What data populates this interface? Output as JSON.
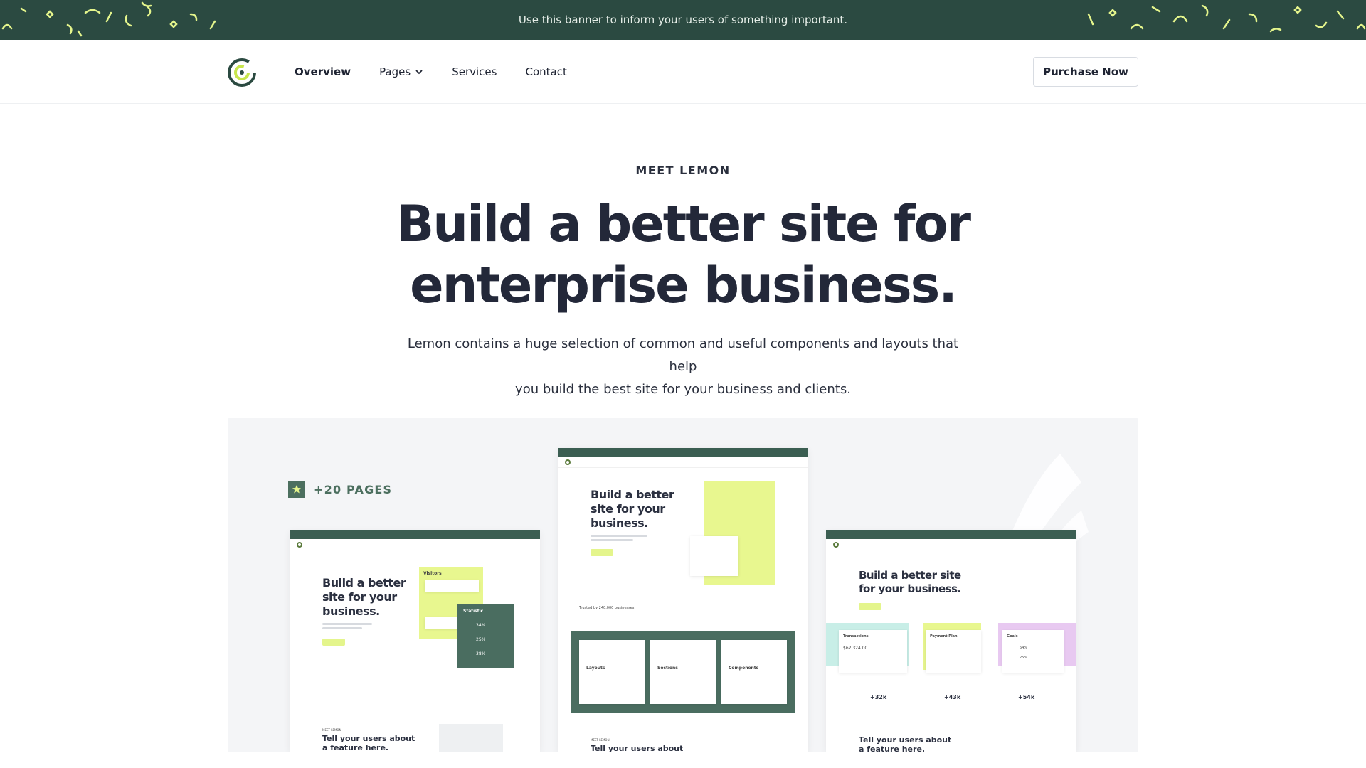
{
  "banner": {
    "text": "Use this banner to inform your users of something important.",
    "color": "#2b4a41",
    "accent": "#e4f58c"
  },
  "nav": {
    "logo_icon": "lemon-logo-icon",
    "links": [
      {
        "label": "Overview",
        "active": true
      },
      {
        "label": "Pages",
        "has_dropdown": true
      },
      {
        "label": "Services"
      },
      {
        "label": "Contact"
      }
    ],
    "purchase_label": "Purchase Now"
  },
  "hero": {
    "eyebrow": "MEET LEMON",
    "headline_line1": "Build a better site for",
    "headline_line2": "enterprise business.",
    "subtext_line1": "Lemon contains a huge selection of common and useful components and layouts that help",
    "subtext_line2": "you build the best site for your business and clients."
  },
  "showcase": {
    "badge_icon": "star-icon",
    "badge_label": "+20 PAGES",
    "mock_left": {
      "title_line1": "Build a better",
      "title_line2": "site for your",
      "title_line3": "business.",
      "card_visitors": "Visitors",
      "card_statistic": "Statistic",
      "stats": [
        "34%",
        "25%",
        "38%"
      ],
      "bottom_eyebrow": "MEET LEMON",
      "bottom_title_line1": "Tell your users about",
      "bottom_title_line2": "a feature here."
    },
    "mock_center": {
      "title_line1": "Build a better",
      "title_line2": "site for your",
      "title_line3": "business.",
      "trusted": "Trusted by 240,000 businesses",
      "cards": [
        "Layouts",
        "Sections",
        "Components"
      ],
      "bottom_eyebrow": "MEET LEMON",
      "bottom_title_line1": "Tell your users about"
    },
    "mock_right": {
      "title_line1": "Build a better site",
      "title_line2": "for your business.",
      "amount": "$62,324.00",
      "card_transactions": "Transactions",
      "card_payment": "Payment Plan",
      "card_goals": "Goals",
      "stats": [
        "+32k",
        "+43k",
        "+54k"
      ],
      "goal_values": [
        "64%",
        "25%"
      ],
      "bottom_title_line1": "Tell your users about",
      "bottom_title_line2": "a feature here."
    }
  }
}
